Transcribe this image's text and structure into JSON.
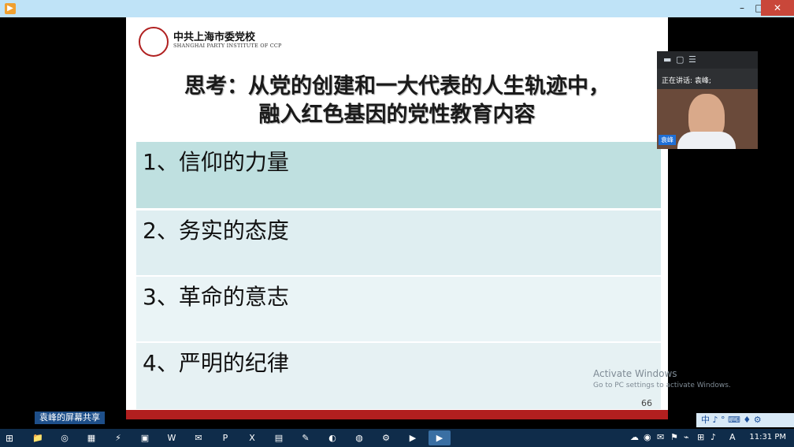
{
  "window": {
    "minimize": "–",
    "maximize": "□",
    "close": "✕",
    "app_icon": "▶"
  },
  "slide": {
    "logo_cn": "中共上海市委党校",
    "logo_en": "SHANGHAI PARTY INSTITUTE OF CCP",
    "headline_line1": "思考：从党的创建和一大代表的人生轨迹中，",
    "headline_line2": "融入红色基因的党性教育内容",
    "items": [
      "1、信仰的力量",
      "2、务实的态度",
      "3、革命的意志",
      "4、严明的纪律"
    ],
    "page_number": "66"
  },
  "video_panel": {
    "speaking_label": "正在讲话: 袁峰;",
    "name_tag": "袁峰",
    "controls": [
      "▬",
      "▢",
      "☰"
    ]
  },
  "watermark": {
    "line1": "Activate Windows",
    "line2": "Go to PC settings to activate Windows."
  },
  "share_bar": {
    "label": "袁峰的屏幕共享"
  },
  "ime_bar": {
    "label": "中 ♪ ° ⌨ ♦ ⚙"
  },
  "taskbar": {
    "start_icon": "⊞",
    "time": "11:31 PM",
    "tray_icons": [
      "☁",
      "◉",
      "✉",
      "⚑",
      "⌁",
      "⊞",
      "♪",
      "A"
    ]
  },
  "colors": {
    "accent_red": "#b21f1f",
    "row1": "#bfe0e0",
    "row2": "#dfeef1",
    "taskbar": "#0f2c4a"
  }
}
